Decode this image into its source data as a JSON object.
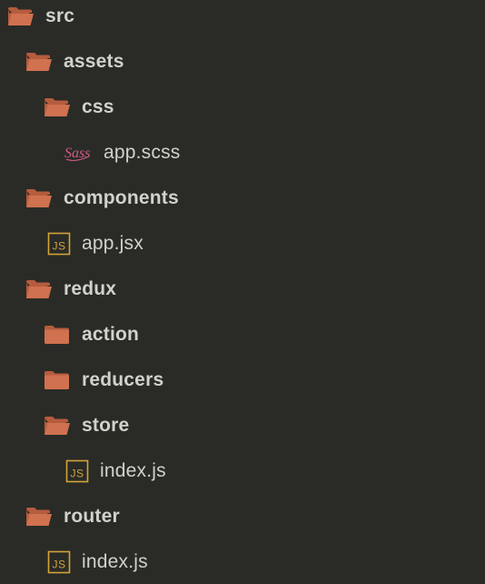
{
  "colors": {
    "background": "#2a2b27",
    "text": "#d1d1cd",
    "folder": "#d0714f",
    "folder_dark": "#b65c3e",
    "js_badge": "#d4a33a",
    "sass_logo": "#cf5b87"
  },
  "tree": {
    "items": [
      {
        "type": "folder",
        "state": "open",
        "depth": 0,
        "label": "src",
        "icon": "folder-open-icon"
      },
      {
        "type": "folder",
        "state": "open",
        "depth": 1,
        "label": "assets",
        "icon": "folder-open-icon"
      },
      {
        "type": "folder",
        "state": "open",
        "depth": 2,
        "label": "css",
        "icon": "folder-open-icon"
      },
      {
        "type": "file",
        "kind": "scss",
        "depth": 3,
        "label": "app.scss",
        "icon": "sass-icon",
        "badge": "Sass"
      },
      {
        "type": "folder",
        "state": "open",
        "depth": 1,
        "label": "components",
        "icon": "folder-open-icon"
      },
      {
        "type": "file",
        "kind": "js",
        "depth": 2,
        "label": "app.jsx",
        "icon": "js-file-icon",
        "badge": "JS"
      },
      {
        "type": "folder",
        "state": "open",
        "depth": 1,
        "label": "redux",
        "icon": "folder-open-icon"
      },
      {
        "type": "folder",
        "state": "closed",
        "depth": 2,
        "label": "action",
        "icon": "folder-closed-icon"
      },
      {
        "type": "folder",
        "state": "closed",
        "depth": 2,
        "label": "reducers",
        "icon": "folder-closed-icon"
      },
      {
        "type": "folder",
        "state": "open",
        "depth": 2,
        "label": "store",
        "icon": "folder-open-icon"
      },
      {
        "type": "file",
        "kind": "js",
        "depth": 3,
        "label": "index.js",
        "icon": "js-file-icon",
        "badge": "JS"
      },
      {
        "type": "folder",
        "state": "open",
        "depth": 1,
        "label": "router",
        "icon": "folder-open-icon"
      },
      {
        "type": "file",
        "kind": "js",
        "depth": 2,
        "label": "index.js",
        "icon": "js-file-icon",
        "badge": "JS"
      }
    ]
  }
}
